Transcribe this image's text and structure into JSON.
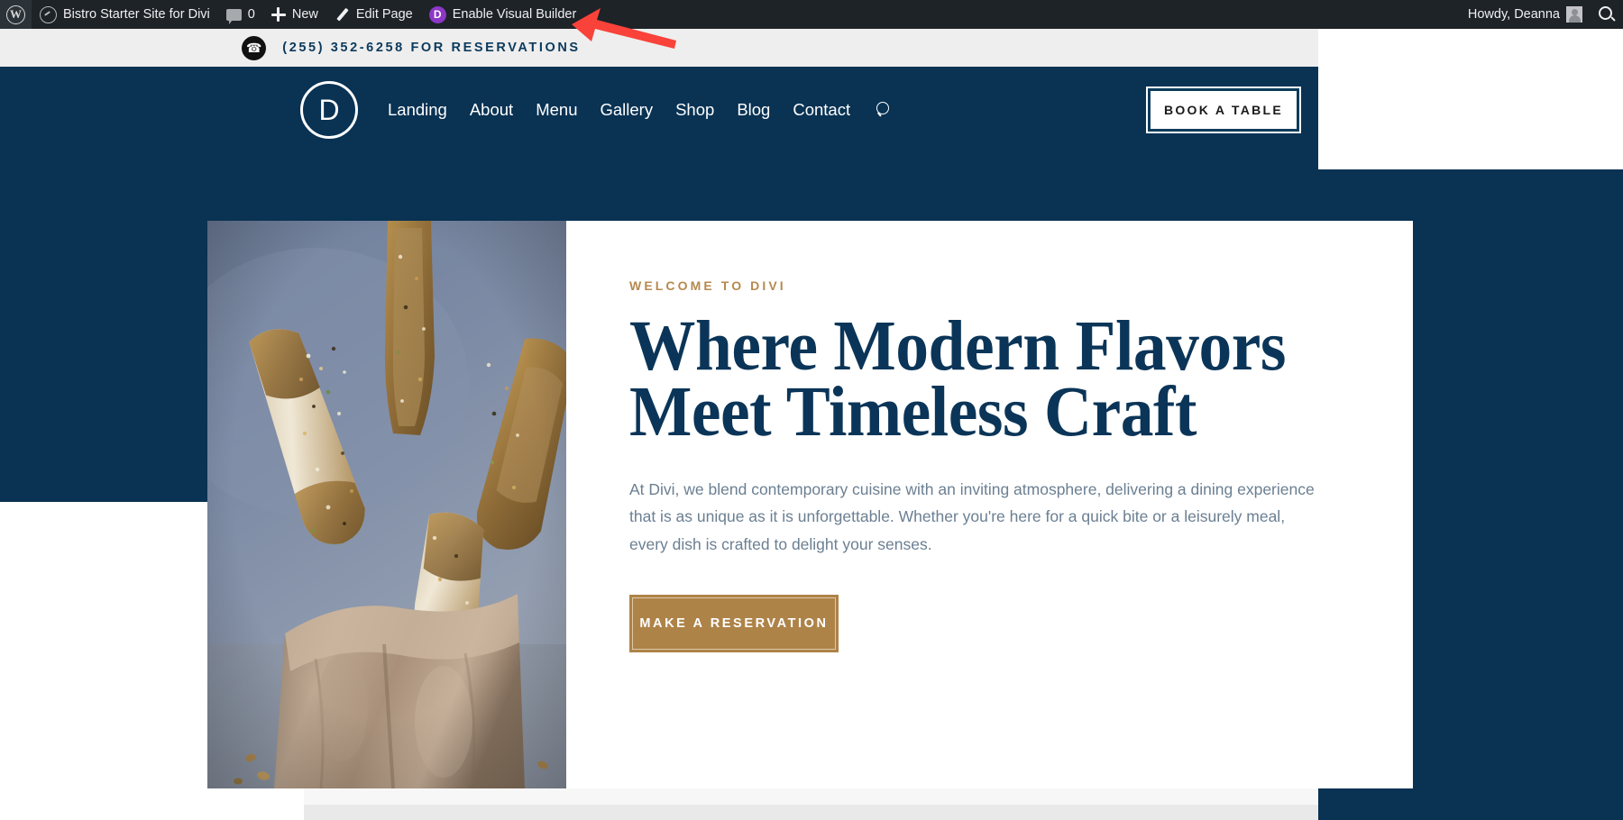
{
  "admin_bar": {
    "wp_logo_icon": "wordpress-logo-icon",
    "site_name": "Bistro Starter Site for Divi",
    "site_icon": "dashboard-icon",
    "comments_icon": "comment-bubble-icon",
    "comments_count": "0",
    "new_icon": "plus-icon",
    "new_label": "New",
    "edit_icon": "pencil-icon",
    "edit_label": "Edit Page",
    "divi_badge": "D",
    "visual_builder_label": "Enable Visual Builder",
    "howdy": "Howdy, Deanna",
    "avatar_icon": "avatar-icon",
    "search_icon": "search-icon"
  },
  "annotation": {
    "arrow_color": "#f9423a",
    "points_to": "Enable Visual Builder"
  },
  "top_bar": {
    "phone_icon": "phone-icon",
    "phone_glyph": "☎",
    "text": "(255) 352-6258 FOR RESERVATIONS",
    "background": "#eeeeee",
    "text_color": "#0b3a5d"
  },
  "header": {
    "background": "#093253",
    "logo_letter": "D",
    "logo_name": "divi-logo",
    "nav": [
      {
        "label": "Landing"
      },
      {
        "label": "About"
      },
      {
        "label": "Menu"
      },
      {
        "label": "Gallery"
      },
      {
        "label": "Shop"
      },
      {
        "label": "Blog"
      },
      {
        "label": "Contact"
      }
    ],
    "search_icon": "search-icon",
    "cta_label": "BOOK A TABLE"
  },
  "hero": {
    "image_alt": "seasoned breadsticks in a brown paper bag on blue-grey background",
    "eyebrow": "WELCOME TO DIVI",
    "title_line1": "Where Modern Flavors",
    "title_line2": "Meet Timeless Craft",
    "body": "At Divi, we blend contemporary cuisine with an inviting atmosphere, delivering a dining experience that is as unique as it is unforgettable. Whether you're here for a quick bite or a leisurely meal, every dish is crafted to delight your senses.",
    "cta_label": "MAKE A RESERVATION",
    "accent_color": "#ae8348",
    "title_color": "#0b3558",
    "body_color": "#6b7f92"
  }
}
